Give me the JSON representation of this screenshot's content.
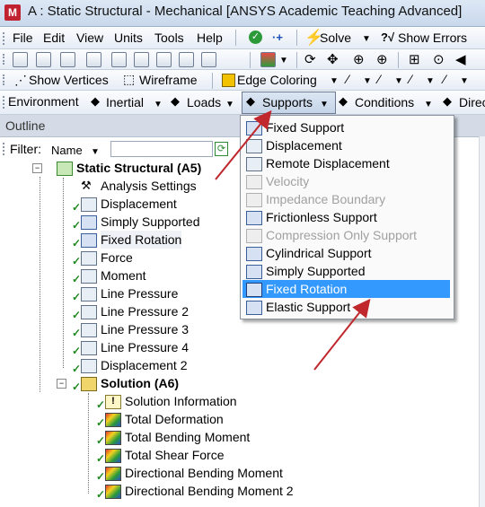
{
  "window": {
    "app_icon": "ansys-logo-icon",
    "title": "A : Static Structural - Mechanical [ANSYS Academic Teaching Advanced]"
  },
  "menubar": {
    "items": [
      "File",
      "Edit",
      "View",
      "Units",
      "Tools",
      "Help"
    ],
    "solve_label": "Solve",
    "show_errors_label": "Show Errors"
  },
  "toolbar2": {
    "show_vertices_label": "Show Vertices",
    "wireframe_label": "Wireframe",
    "edge_coloring_label": "Edge Coloring"
  },
  "context_toolbar": {
    "environment_label": "Environment",
    "inertial_label": "Inertial",
    "loads_label": "Loads",
    "supports_label": "Supports",
    "conditions_label": "Conditions",
    "direct_label": "Direc"
  },
  "outline": {
    "title": "Outline",
    "filter_label": "Filter:",
    "filter_option": "Name",
    "tree": [
      {
        "label": "Static Structural (A5)",
        "bold": true,
        "icon": "static-structural-icon"
      },
      {
        "label": "Analysis Settings",
        "icon": "analysis-settings-icon"
      },
      {
        "label": "Displacement",
        "icon": "displacement-icon"
      },
      {
        "label": "Simply Supported",
        "icon": "simply-supported-icon"
      },
      {
        "label": "Fixed Rotation",
        "icon": "fixed-rotation-icon"
      },
      {
        "label": "Force",
        "icon": "force-icon"
      },
      {
        "label": "Moment",
        "icon": "moment-icon"
      },
      {
        "label": "Line Pressure",
        "icon": "line-pressure-icon"
      },
      {
        "label": "Line Pressure 2",
        "icon": "line-pressure-icon"
      },
      {
        "label": "Line Pressure 3",
        "icon": "line-pressure-icon"
      },
      {
        "label": "Line Pressure 4",
        "icon": "line-pressure-icon"
      },
      {
        "label": "Displacement 2",
        "icon": "displacement-icon"
      },
      {
        "label": "Solution (A6)",
        "bold": true,
        "icon": "solution-icon"
      },
      {
        "label": "Solution Information",
        "icon": "solution-information-icon"
      },
      {
        "label": "Total Deformation",
        "icon": "result-icon"
      },
      {
        "label": "Total Bending Moment",
        "icon": "result-icon"
      },
      {
        "label": "Total Shear Force",
        "icon": "result-icon"
      },
      {
        "label": "Directional Bending Moment",
        "icon": "result-icon"
      },
      {
        "label": "Directional Bending Moment 2",
        "icon": "result-icon"
      }
    ]
  },
  "supports_menu": {
    "items": [
      {
        "label": "Fixed Support",
        "enabled": true
      },
      {
        "label": "Displacement",
        "enabled": true
      },
      {
        "label": "Remote Displacement",
        "enabled": true
      },
      {
        "label": "Velocity",
        "enabled": false
      },
      {
        "label": "Impedance Boundary",
        "enabled": false
      },
      {
        "label": "Frictionless Support",
        "enabled": true
      },
      {
        "label": "Compression Only Support",
        "enabled": false
      },
      {
        "label": "Cylindrical Support",
        "enabled": true
      },
      {
        "label": "Simply Supported",
        "enabled": true
      },
      {
        "label": "Fixed Rotation",
        "enabled": true,
        "selected": true
      },
      {
        "label": "Elastic Support",
        "enabled": true
      }
    ]
  },
  "colors": {
    "accent_selected": "#3399ff",
    "annotation_arrow": "#c0282d",
    "check_green": "#1f8a1f"
  }
}
